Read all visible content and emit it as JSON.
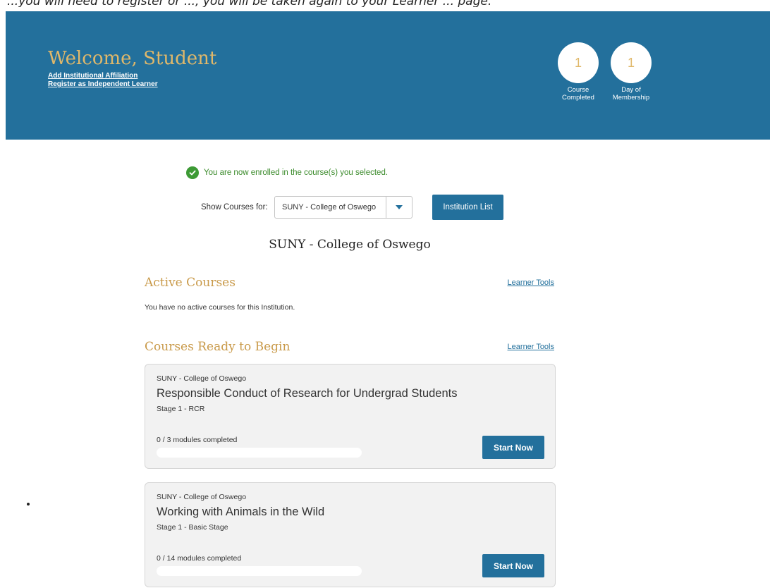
{
  "top_note": "...you will need to register or ..., you will be taken again to your Learner ... page.",
  "header": {
    "welcome": "Welcome, Student",
    "links": [
      "Add Institutional Affiliation",
      "Register as Independent Learner"
    ],
    "stats": [
      {
        "value": "1",
        "label": "Course\nCompleted"
      },
      {
        "value": "1",
        "label": "Day of\nMembership"
      }
    ]
  },
  "notice": {
    "text": "You are now enrolled in the course(s) you selected.",
    "icon": "check-circle-icon",
    "color": "#3a8a2a"
  },
  "filter": {
    "label": "Show Courses for:",
    "selected": "SUNY - College of Oswego",
    "button": "Institution List"
  },
  "institution_title": "SUNY - College of Oswego",
  "active": {
    "title": "Active Courses",
    "tools_link": "Learner Tools",
    "empty_message": "You have no active courses for this Institution."
  },
  "ready": {
    "title": "Courses Ready to Begin",
    "tools_link": "Learner Tools",
    "courses": [
      {
        "institution": "SUNY - College of Oswego",
        "title": "Responsible Conduct of Research for Undergrad Students",
        "stage": "Stage 1 - RCR",
        "progress_text": "0 / 3 modules completed",
        "progress": 0,
        "button": "Start Now"
      },
      {
        "institution": "SUNY - College of Oswego",
        "title": "Working with Animals in the Wild",
        "stage": "Stage 1 - Basic Stage",
        "progress_text": "0 / 14 modules completed",
        "progress": 0,
        "button": "Start Now"
      }
    ]
  },
  "colors": {
    "brand": "#23709c",
    "gold": "#c99a4a",
    "success": "#3a8a2a"
  }
}
